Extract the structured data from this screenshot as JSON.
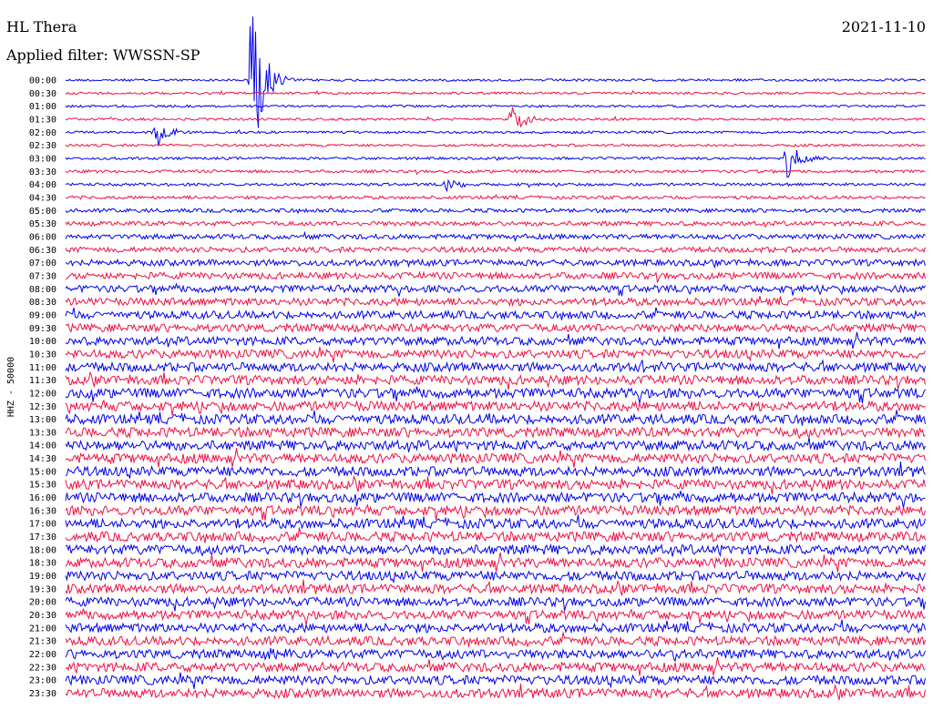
{
  "header": {
    "station": "HL Thera",
    "filter": "Applied filter: WWSSN-SP",
    "date": "2021-11-10"
  },
  "chart_data": {
    "type": "line",
    "title": "HL Thera",
    "subtitle": "Applied filter: WWSSN-SP",
    "ylabel": "HHZ - 50000",
    "xlabel": "",
    "row_labels": [
      "00:00",
      "00:30",
      "01:00",
      "01:30",
      "02:00",
      "02:30",
      "03:00",
      "03:30",
      "04:00",
      "04:30",
      "05:00",
      "05:30",
      "06:00",
      "06:30",
      "07:00",
      "07:30",
      "08:00",
      "08:30",
      "09:00",
      "09:30",
      "10:00",
      "10:30",
      "11:00",
      "11:30",
      "12:00",
      "12:30",
      "13:00",
      "13:30",
      "14:00",
      "14:30",
      "15:00",
      "15:30",
      "16:00",
      "16:30",
      "17:00",
      "17:30",
      "18:00",
      "18:30",
      "19:00",
      "19:30",
      "20:00",
      "20:30",
      "21:00",
      "21:30",
      "22:00",
      "22:30",
      "23:00",
      "23:30"
    ],
    "trace_colors": [
      "#0000ee",
      "#ee1144"
    ],
    "noise_level": [
      0.18,
      0.18,
      0.18,
      0.18,
      0.18,
      0.2,
      0.2,
      0.22,
      0.22,
      0.25,
      0.3,
      0.35,
      0.38,
      0.42,
      0.48,
      0.52,
      0.55,
      0.58,
      0.6,
      0.62,
      0.65,
      0.68,
      0.7,
      0.72,
      0.75,
      0.75,
      0.75,
      0.75,
      0.75,
      0.75,
      0.75,
      0.75,
      0.75,
      0.75,
      0.75,
      0.75,
      0.75,
      0.75,
      0.72,
      0.72,
      0.7,
      0.7,
      0.7,
      0.7,
      0.7,
      0.72,
      0.72,
      0.72
    ],
    "events": [
      {
        "row": 0,
        "x": 0.216,
        "amplitude": 15
      },
      {
        "row": 4,
        "x": 0.103,
        "amplitude": 3.5
      },
      {
        "row": 3,
        "x": 0.519,
        "amplitude": 3.5
      },
      {
        "row": 6,
        "x": 0.838,
        "amplitude": 4.0
      },
      {
        "row": 8,
        "x": 0.443,
        "amplitude": 1.2
      },
      {
        "row": 22,
        "x": 0.672,
        "amplitude": 1.0
      },
      {
        "row": 44,
        "x": 0.232,
        "amplitude": 1.0
      },
      {
        "row": 44,
        "x": 0.703,
        "amplitude": 1.0
      }
    ]
  }
}
